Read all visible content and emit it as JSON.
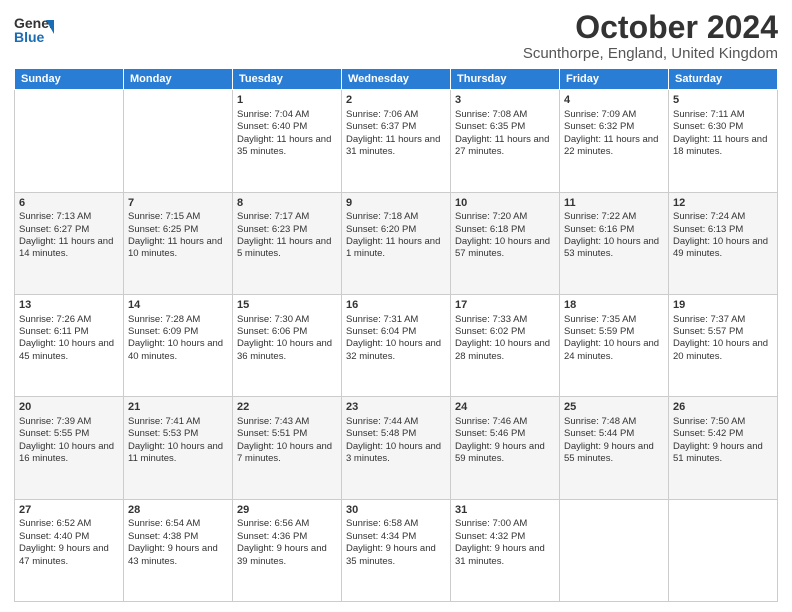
{
  "header": {
    "logo_general": "General",
    "logo_blue": "Blue",
    "title": "October 2024",
    "subtitle": "Scunthorpe, England, United Kingdom"
  },
  "calendar": {
    "days_of_week": [
      "Sunday",
      "Monday",
      "Tuesday",
      "Wednesday",
      "Thursday",
      "Friday",
      "Saturday"
    ],
    "weeks": [
      [
        {
          "day": "",
          "sunrise": "",
          "sunset": "",
          "daylight": ""
        },
        {
          "day": "",
          "sunrise": "",
          "sunset": "",
          "daylight": ""
        },
        {
          "day": "1",
          "sunrise": "Sunrise: 7:04 AM",
          "sunset": "Sunset: 6:40 PM",
          "daylight": "Daylight: 11 hours and 35 minutes."
        },
        {
          "day": "2",
          "sunrise": "Sunrise: 7:06 AM",
          "sunset": "Sunset: 6:37 PM",
          "daylight": "Daylight: 11 hours and 31 minutes."
        },
        {
          "day": "3",
          "sunrise": "Sunrise: 7:08 AM",
          "sunset": "Sunset: 6:35 PM",
          "daylight": "Daylight: 11 hours and 27 minutes."
        },
        {
          "day": "4",
          "sunrise": "Sunrise: 7:09 AM",
          "sunset": "Sunset: 6:32 PM",
          "daylight": "Daylight: 11 hours and 22 minutes."
        },
        {
          "day": "5",
          "sunrise": "Sunrise: 7:11 AM",
          "sunset": "Sunset: 6:30 PM",
          "daylight": "Daylight: 11 hours and 18 minutes."
        }
      ],
      [
        {
          "day": "6",
          "sunrise": "Sunrise: 7:13 AM",
          "sunset": "Sunset: 6:27 PM",
          "daylight": "Daylight: 11 hours and 14 minutes."
        },
        {
          "day": "7",
          "sunrise": "Sunrise: 7:15 AM",
          "sunset": "Sunset: 6:25 PM",
          "daylight": "Daylight: 11 hours and 10 minutes."
        },
        {
          "day": "8",
          "sunrise": "Sunrise: 7:17 AM",
          "sunset": "Sunset: 6:23 PM",
          "daylight": "Daylight: 11 hours and 5 minutes."
        },
        {
          "day": "9",
          "sunrise": "Sunrise: 7:18 AM",
          "sunset": "Sunset: 6:20 PM",
          "daylight": "Daylight: 11 hours and 1 minute."
        },
        {
          "day": "10",
          "sunrise": "Sunrise: 7:20 AM",
          "sunset": "Sunset: 6:18 PM",
          "daylight": "Daylight: 10 hours and 57 minutes."
        },
        {
          "day": "11",
          "sunrise": "Sunrise: 7:22 AM",
          "sunset": "Sunset: 6:16 PM",
          "daylight": "Daylight: 10 hours and 53 minutes."
        },
        {
          "day": "12",
          "sunrise": "Sunrise: 7:24 AM",
          "sunset": "Sunset: 6:13 PM",
          "daylight": "Daylight: 10 hours and 49 minutes."
        }
      ],
      [
        {
          "day": "13",
          "sunrise": "Sunrise: 7:26 AM",
          "sunset": "Sunset: 6:11 PM",
          "daylight": "Daylight: 10 hours and 45 minutes."
        },
        {
          "day": "14",
          "sunrise": "Sunrise: 7:28 AM",
          "sunset": "Sunset: 6:09 PM",
          "daylight": "Daylight: 10 hours and 40 minutes."
        },
        {
          "day": "15",
          "sunrise": "Sunrise: 7:30 AM",
          "sunset": "Sunset: 6:06 PM",
          "daylight": "Daylight: 10 hours and 36 minutes."
        },
        {
          "day": "16",
          "sunrise": "Sunrise: 7:31 AM",
          "sunset": "Sunset: 6:04 PM",
          "daylight": "Daylight: 10 hours and 32 minutes."
        },
        {
          "day": "17",
          "sunrise": "Sunrise: 7:33 AM",
          "sunset": "Sunset: 6:02 PM",
          "daylight": "Daylight: 10 hours and 28 minutes."
        },
        {
          "day": "18",
          "sunrise": "Sunrise: 7:35 AM",
          "sunset": "Sunset: 5:59 PM",
          "daylight": "Daylight: 10 hours and 24 minutes."
        },
        {
          "day": "19",
          "sunrise": "Sunrise: 7:37 AM",
          "sunset": "Sunset: 5:57 PM",
          "daylight": "Daylight: 10 hours and 20 minutes."
        }
      ],
      [
        {
          "day": "20",
          "sunrise": "Sunrise: 7:39 AM",
          "sunset": "Sunset: 5:55 PM",
          "daylight": "Daylight: 10 hours and 16 minutes."
        },
        {
          "day": "21",
          "sunrise": "Sunrise: 7:41 AM",
          "sunset": "Sunset: 5:53 PM",
          "daylight": "Daylight: 10 hours and 11 minutes."
        },
        {
          "day": "22",
          "sunrise": "Sunrise: 7:43 AM",
          "sunset": "Sunset: 5:51 PM",
          "daylight": "Daylight: 10 hours and 7 minutes."
        },
        {
          "day": "23",
          "sunrise": "Sunrise: 7:44 AM",
          "sunset": "Sunset: 5:48 PM",
          "daylight": "Daylight: 10 hours and 3 minutes."
        },
        {
          "day": "24",
          "sunrise": "Sunrise: 7:46 AM",
          "sunset": "Sunset: 5:46 PM",
          "daylight": "Daylight: 9 hours and 59 minutes."
        },
        {
          "day": "25",
          "sunrise": "Sunrise: 7:48 AM",
          "sunset": "Sunset: 5:44 PM",
          "daylight": "Daylight: 9 hours and 55 minutes."
        },
        {
          "day": "26",
          "sunrise": "Sunrise: 7:50 AM",
          "sunset": "Sunset: 5:42 PM",
          "daylight": "Daylight: 9 hours and 51 minutes."
        }
      ],
      [
        {
          "day": "27",
          "sunrise": "Sunrise: 6:52 AM",
          "sunset": "Sunset: 4:40 PM",
          "daylight": "Daylight: 9 hours and 47 minutes."
        },
        {
          "day": "28",
          "sunrise": "Sunrise: 6:54 AM",
          "sunset": "Sunset: 4:38 PM",
          "daylight": "Daylight: 9 hours and 43 minutes."
        },
        {
          "day": "29",
          "sunrise": "Sunrise: 6:56 AM",
          "sunset": "Sunset: 4:36 PM",
          "daylight": "Daylight: 9 hours and 39 minutes."
        },
        {
          "day": "30",
          "sunrise": "Sunrise: 6:58 AM",
          "sunset": "Sunset: 4:34 PM",
          "daylight": "Daylight: 9 hours and 35 minutes."
        },
        {
          "day": "31",
          "sunrise": "Sunrise: 7:00 AM",
          "sunset": "Sunset: 4:32 PM",
          "daylight": "Daylight: 9 hours and 31 minutes."
        },
        {
          "day": "",
          "sunrise": "",
          "sunset": "",
          "daylight": ""
        },
        {
          "day": "",
          "sunrise": "",
          "sunset": "",
          "daylight": ""
        }
      ]
    ]
  }
}
